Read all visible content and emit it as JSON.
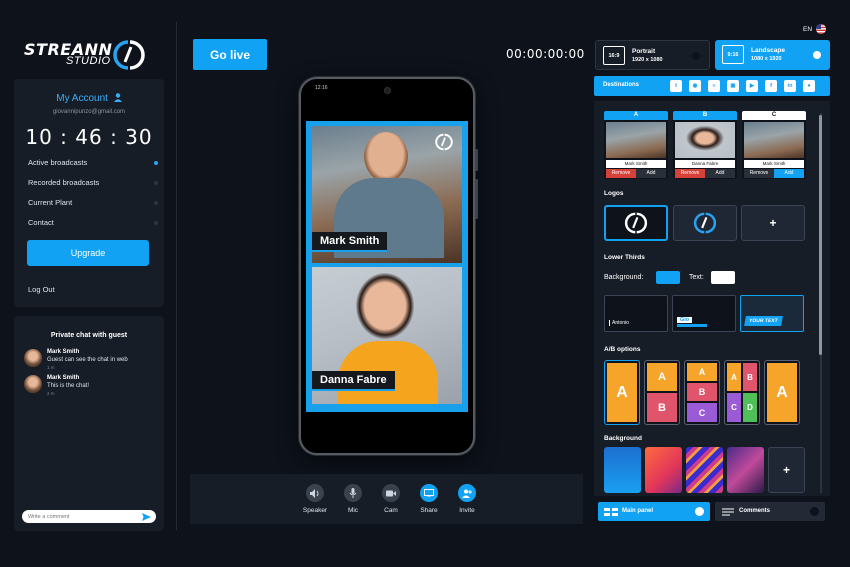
{
  "brand": {
    "name_line1": "STREANN",
    "name_line2": "STUDIO"
  },
  "account": {
    "title": "My Account",
    "email": "giovannipunzo@gmail.com",
    "clock": "10 : 46 : 30",
    "menu": [
      {
        "label": "Active broadcasts",
        "active": true
      },
      {
        "label": "Recorded broadcasts",
        "active": false
      },
      {
        "label": "Current Plant",
        "active": false
      },
      {
        "label": "Contact",
        "active": false
      }
    ],
    "upgrade_label": "Upgrade",
    "logout_label": "Log Out"
  },
  "chat": {
    "title": "Private chat with guest",
    "messages": [
      {
        "name": "Mark Smith",
        "text": "Guest can see the chat in web",
        "time": "1 m"
      },
      {
        "name": "Mark Smith",
        "text": "This is the chat!",
        "time": "2 m"
      }
    ],
    "input_placeholder": "Write a comment"
  },
  "top": {
    "go_live_label": "Go live",
    "timer": "00:00:00:00",
    "lang": "EN"
  },
  "phone": {
    "status_time": "12:16",
    "feeds": [
      {
        "name": "Mark Smith"
      },
      {
        "name": "Danna Fabre"
      }
    ]
  },
  "controls": [
    {
      "label": "Speaker",
      "icon": "speaker-icon",
      "active": false
    },
    {
      "label": "Mic",
      "icon": "mic-icon",
      "active": false
    },
    {
      "label": "Cam",
      "icon": "cam-icon",
      "active": false
    },
    {
      "label": "Share",
      "icon": "share-icon",
      "active": true
    },
    {
      "label": "Invite",
      "icon": "invite-icon",
      "active": true
    }
  ],
  "orientation": {
    "portrait": {
      "ratio": "16:9",
      "label": "Portrait",
      "size": "1920 x 1080",
      "selected": false
    },
    "landscape": {
      "ratio": "9:16",
      "label": "Landscape",
      "size": "1080 x 1920",
      "selected": true
    }
  },
  "destinations": {
    "label": "Destinations",
    "icons": [
      "twitch-icon",
      "periscope-icon",
      "rtmp-icon",
      "custom-icon",
      "youtube-icon",
      "facebook-icon",
      "linkedin-icon",
      "generic-icon"
    ]
  },
  "guests": [
    {
      "slot": "A",
      "name": "Mark Smith",
      "remove": "Remove",
      "add": "Add",
      "state": "on-air"
    },
    {
      "slot": "B",
      "name": "Danna Fabre",
      "remove": "Remove",
      "add": "Add",
      "state": "on-air"
    },
    {
      "slot": "C",
      "name": "Mark Smith",
      "remove": "Remove",
      "add": "Add",
      "state": "available"
    }
  ],
  "sections": {
    "logos": "Logos",
    "lower_thirds": "Lower Thirds",
    "ab_options": "A/B options",
    "background": "Background"
  },
  "lower_thirds": {
    "background_label": "Background:",
    "text_label": "Text:",
    "background_color": "#12a2f3",
    "text_color": "#ffffff",
    "styles": [
      "Antonio",
      "Gio",
      "YOUR TEXT"
    ]
  },
  "ab_layouts": [
    {
      "cells": [
        "A"
      ]
    },
    {
      "cells": [
        "A",
        "B"
      ]
    },
    {
      "cells": [
        "A",
        "B",
        "C"
      ]
    },
    {
      "cells": [
        "A",
        "B",
        "C",
        "D"
      ]
    },
    {
      "cells": [
        "A"
      ]
    }
  ],
  "bottom_tabs": {
    "main_panel": "Main panel",
    "comments": "Comments"
  },
  "colors": {
    "accent": "#12a2f3",
    "bg": "#0d121b",
    "panel": "#171d27"
  }
}
